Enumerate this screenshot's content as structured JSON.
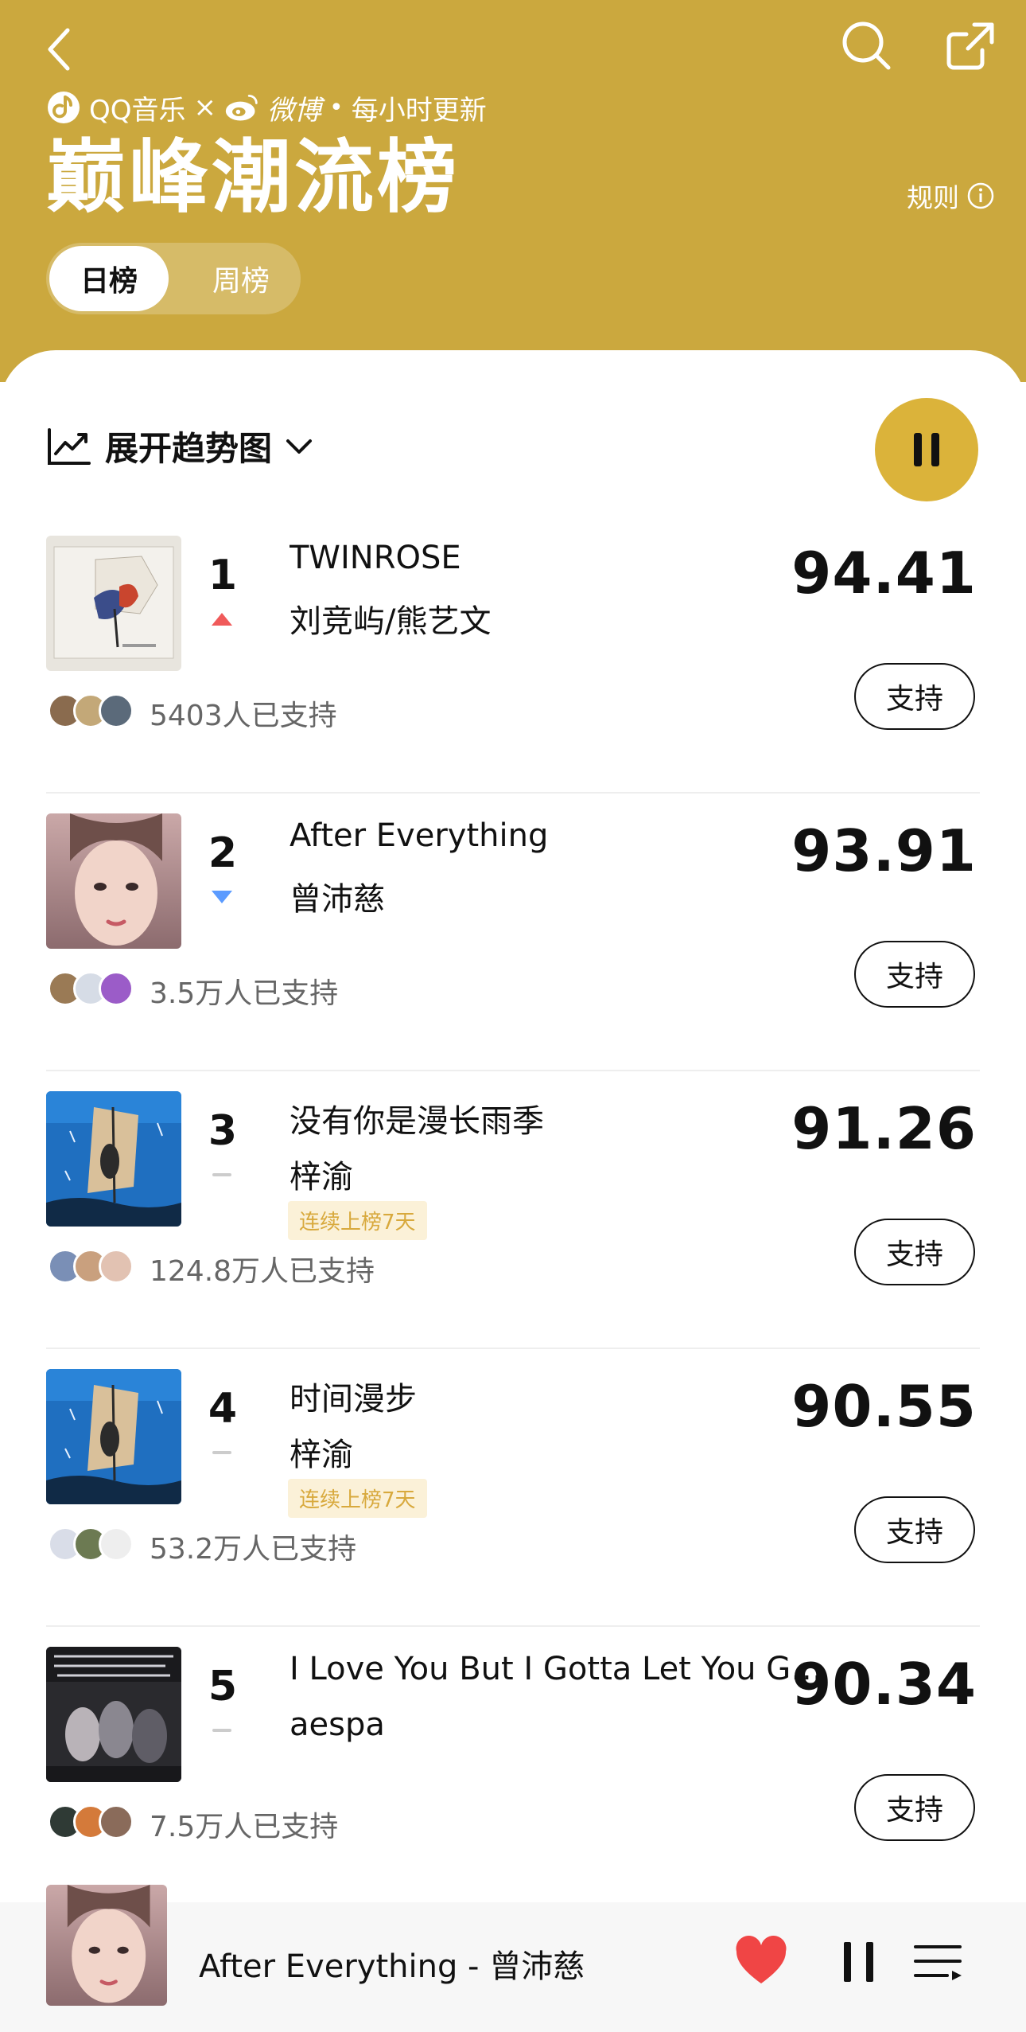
{
  "header": {
    "brand_qq": "QQ音乐",
    "brand_times": "×",
    "brand_weibo": "微博",
    "brand_dot": "•",
    "update_note": "每小时更新",
    "title": "巅峰潮流榜",
    "rules_label": "规则"
  },
  "tabs": [
    {
      "label": "日榜",
      "active": true
    },
    {
      "label": "周榜",
      "active": false
    }
  ],
  "toolbar": {
    "trend_label": "展开趋势图"
  },
  "colors": {
    "hero": "#cba83e",
    "play_button": "#dbb33a",
    "trend_up": "#f05a5a",
    "trend_down": "#5b9bff",
    "trend_flat": "#cccccc",
    "heart": "#f04545"
  },
  "songs": [
    {
      "rank": "1",
      "title": "TWINROSE",
      "artist": "刘竞屿/熊艺文",
      "score": "94.41",
      "trend": "up",
      "streak": "",
      "support": "5403人已支持",
      "support_btn": "支持"
    },
    {
      "rank": "2",
      "title": "After Everything",
      "artist": "曾沛慈",
      "score": "93.91",
      "trend": "down",
      "streak": "",
      "support": "3.5万人已支持",
      "support_btn": "支持"
    },
    {
      "rank": "3",
      "title": "没有你是漫长雨季",
      "artist": "梓渝",
      "score": "91.26",
      "trend": "flat",
      "streak": "连续上榜7天",
      "support": "124.8万人已支持",
      "support_btn": "支持"
    },
    {
      "rank": "4",
      "title": "时间漫步",
      "artist": "梓渝",
      "score": "90.55",
      "trend": "flat",
      "streak": "连续上榜7天",
      "support": "53.2万人已支持",
      "support_btn": "支持"
    },
    {
      "rank": "5",
      "title": "I Love You But I Gotta Let You Go...",
      "artist": "aespa",
      "score": "90.34",
      "trend": "flat",
      "streak": "",
      "support": "7.5万人已支持",
      "support_btn": "支持"
    }
  ],
  "player": {
    "now_playing": "After Everything - 曾沛慈"
  }
}
